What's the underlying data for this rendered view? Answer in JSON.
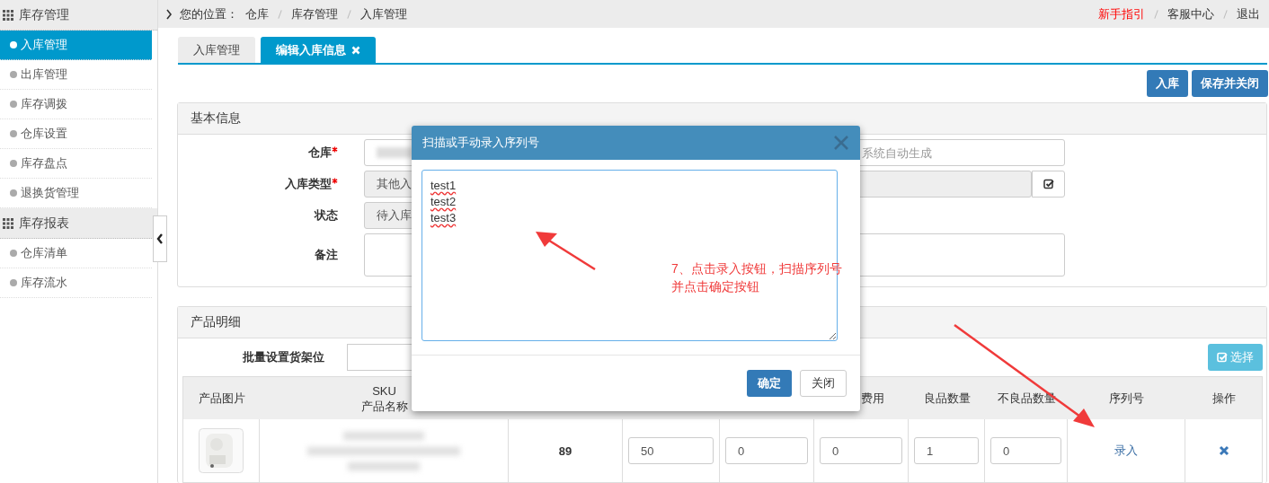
{
  "sidebar": {
    "sections": [
      {
        "title": "库存管理",
        "items": [
          {
            "label": "入库管理",
            "selected": true
          },
          {
            "label": "出库管理",
            "selected": false
          },
          {
            "label": "库存调拨",
            "selected": false
          },
          {
            "label": "仓库设置",
            "selected": false
          },
          {
            "label": "库存盘点",
            "selected": false
          },
          {
            "label": "退换货管理",
            "selected": false
          }
        ]
      },
      {
        "title": "库存报表",
        "items": [
          {
            "label": "仓库清单",
            "selected": false
          },
          {
            "label": "库存流水",
            "selected": false
          }
        ]
      }
    ]
  },
  "breadcrumb": {
    "prefix": "您的位置：",
    "items": [
      "仓库",
      "库存管理",
      "入库管理"
    ]
  },
  "top_links": [
    {
      "label": "新手指引",
      "highlighted": true
    },
    {
      "label": "客服中心",
      "highlighted": false
    },
    {
      "label": "退出",
      "highlighted": false
    }
  ],
  "tabs": [
    {
      "label": "入库管理",
      "selected": false,
      "closable": false
    },
    {
      "label": "编辑入库信息",
      "selected": true,
      "closable": true
    }
  ],
  "actions": [
    "入库",
    "保存并关闭"
  ],
  "basic_info": {
    "title": "基本信息",
    "rows": [
      {
        "label": "仓库",
        "required": true,
        "kind": "pair",
        "placeholder": "系统自动生成"
      },
      {
        "label": "入库类型",
        "required": true,
        "kind": "select",
        "value": "其他入"
      },
      {
        "label": "状态",
        "required": false,
        "kind": "readonly",
        "value": "待入库"
      },
      {
        "label": "备注",
        "required": false,
        "kind": "textarea"
      }
    ]
  },
  "products": {
    "title": "产品明细",
    "batch_label": "批量设置货架位",
    "select_button": "选择",
    "table": {
      "columns": [
        {
          "label": "产品图片"
        },
        {
          "label": "SKU",
          "sublabel": "产品名称"
        },
        {},
        {},
        {},
        {
          "label": "费用"
        },
        {
          "label": "良品数量"
        },
        {
          "label": "不良品数量"
        },
        {
          "label": "序列号"
        },
        {
          "label": "操作"
        }
      ],
      "rows": [
        [
          {
            "kind": "picture"
          },
          {
            "kind": "redacted"
          },
          {
            "kind": "number",
            "text": "89"
          },
          {
            "kind": "input",
            "value": "50"
          },
          {
            "kind": "input",
            "value": "0"
          },
          {
            "kind": "input",
            "value": "0"
          },
          {
            "kind": "input",
            "value": "1"
          },
          {
            "kind": "input",
            "value": "0"
          },
          {
            "kind": "link",
            "text": "录入"
          },
          {
            "kind": "delete"
          }
        ]
      ]
    }
  },
  "dialog": {
    "title": "扫描或手动录入序列号",
    "value": "test1\ntest2\ntest3",
    "buttons": [
      {
        "label": "确定",
        "primary": true
      },
      {
        "label": "关闭",
        "primary": false
      }
    ]
  },
  "annotation": {
    "lines": [
      "7、点击录入按钮，扫描序列号",
      "并点击确定按钮"
    ]
  }
}
